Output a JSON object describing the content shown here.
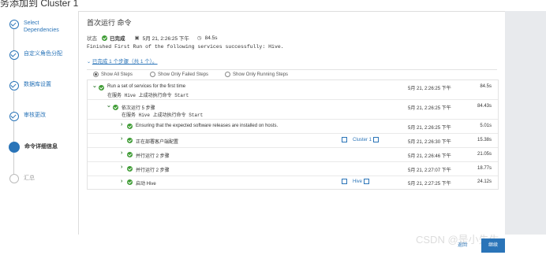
{
  "page": {
    "title": "务添加到 Cluster 1"
  },
  "wizard": {
    "steps": [
      {
        "label": "Select Dependencies",
        "state": "done"
      },
      {
        "label": "自定义角色分配",
        "state": "done"
      },
      {
        "label": "数据库设置",
        "state": "done"
      },
      {
        "label": "审核更改",
        "state": "done"
      },
      {
        "label": "命令详细信息",
        "state": "active"
      },
      {
        "label": "汇总",
        "state": "pending"
      }
    ]
  },
  "command": {
    "title": "首次运行 命令",
    "status_label": "状态",
    "status_value": "已完成",
    "date": "5月 21, 2:26:25 下午",
    "duration": "84.5s",
    "message": "Finished First Run of the following services successfully: Hive.",
    "summary": "已完成 1 个步骤（共 1 个）。"
  },
  "filters": {
    "all": "Show All Steps",
    "failed": "Show Only Failed Steps",
    "running": "Show Only Running Steps",
    "selected": "all"
  },
  "table": {
    "rows": [
      {
        "name": "Run a set of services for the first time",
        "sub": "在服务 Hive 上成功执行命令 Start",
        "time": "5月 21, 2:26:25 下午",
        "duration": "84.5s"
      },
      {
        "name": "依次运行 5 步骤",
        "sub": "在服务 Hive 上成功执行命令 Start",
        "time": "5月 21, 2:26:25 下午",
        "duration": "84.43s"
      },
      {
        "name": "Ensuring that the expected software releases are installed on hosts.",
        "time": "5月 21, 2:26:25 下午",
        "duration": "5.01s"
      },
      {
        "name": "正在部署客户端配置",
        "link": "Cluster 1",
        "time": "5月 21, 2:26:30 下午",
        "duration": "15.38s"
      },
      {
        "name": "并行运行 2 步骤",
        "time": "5月 21, 2:26:46 下午",
        "duration": "21.05s"
      },
      {
        "name": "并行运行 2 步骤",
        "time": "5月 21, 2:27:07 下午",
        "duration": "18.77s"
      },
      {
        "name": "启动 Hive",
        "link": "Hive",
        "time": "5月 21, 2:27:25 下午",
        "duration": "24.12s"
      }
    ]
  },
  "footer": {
    "watermark": "CSDN @是小先生",
    "back": "返回",
    "next": "继续"
  },
  "colors": {
    "accent": "#2a74b8",
    "success": "#3f9c35",
    "sidebar_gray": "#e8eaed"
  }
}
